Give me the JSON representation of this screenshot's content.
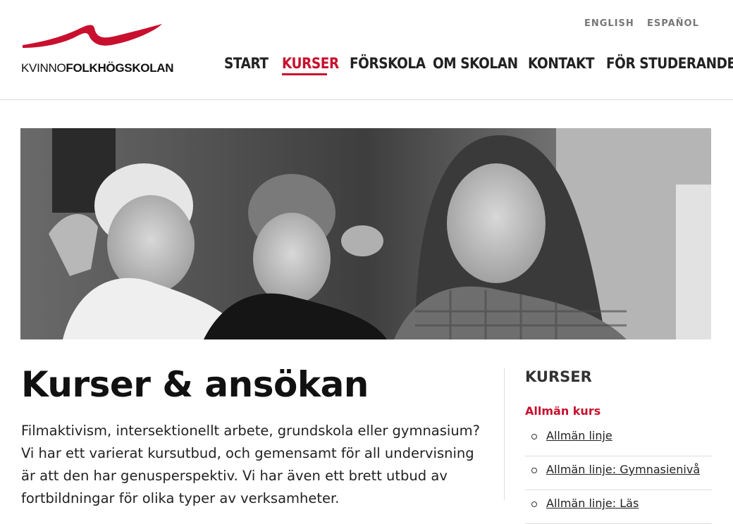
{
  "brand": {
    "logo_light": "KVINNO",
    "logo_bold": "FOLKHÖGSKOLAN",
    "accent_color": "#c8102e"
  },
  "languages": [
    "ENGLISH",
    "ESPAÑOL"
  ],
  "nav": {
    "items": [
      "START",
      "KURSER",
      "FÖRSKOLA",
      "OM SKOLAN",
      "KONTAKT",
      "FÖR STUDERANDE"
    ],
    "active": "KURSER"
  },
  "hero": {
    "image": "black-and-white photo of students"
  },
  "main": {
    "title": "Kurser & ansökan",
    "intro": "Filmaktivism, intersektionellt arbete, grundskola eller gymnasium? Vi har ett varierat kursutbud, och gemensamt för all undervisning är att den har genusperspektiv. Vi har även ett brett utbud av fortbildningar för olika typer av verksamheter."
  },
  "sidebar": {
    "title": "KURSER",
    "section": "Allmän kurs",
    "items": [
      "Allmän linje",
      "Allmän linje: Gymnasienivå",
      "Allmän linje: Läs"
    ]
  }
}
